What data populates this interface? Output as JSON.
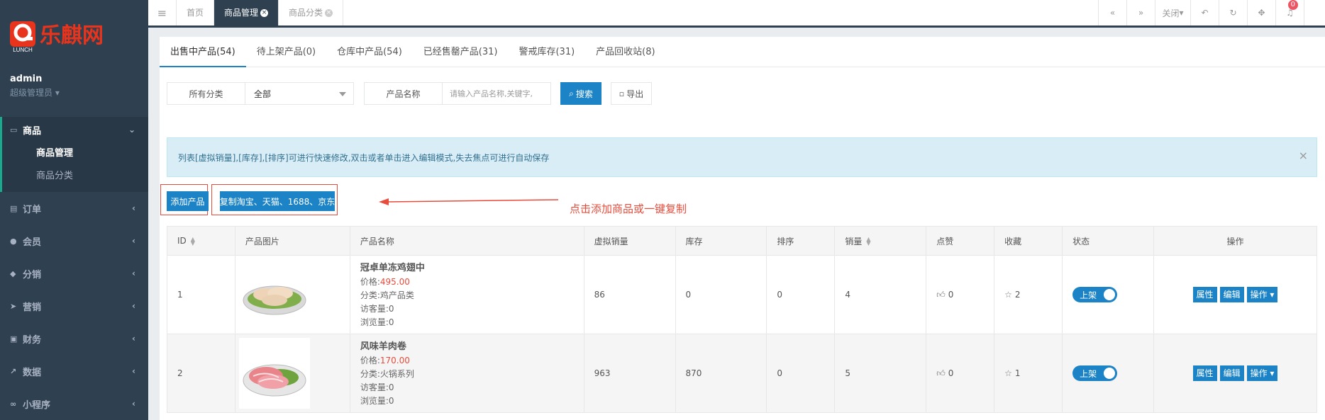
{
  "sidebar": {
    "logo_text": "乐麒网",
    "logo_sub": "LUNCH",
    "user_name": "admin",
    "user_role": "超级管理员",
    "active_group": {
      "label": "商品",
      "items": [
        {
          "label": "商品管理",
          "current": true
        },
        {
          "label": "商品分类",
          "current": false
        }
      ]
    },
    "items": [
      {
        "label": "订单",
        "icon": "order-icon"
      },
      {
        "label": "会员",
        "icon": "user-icon"
      },
      {
        "label": "分销",
        "icon": "distribution-icon"
      },
      {
        "label": "营销",
        "icon": "send-icon"
      },
      {
        "label": "财务",
        "icon": "money-icon"
      },
      {
        "label": "数据",
        "icon": "chart-icon"
      },
      {
        "label": "小程序",
        "icon": "miniprogram-icon"
      }
    ]
  },
  "topbar": {
    "tabs": [
      {
        "label": "首页"
      },
      {
        "label": "商品管理",
        "active": true
      },
      {
        "label": "商品分类"
      }
    ],
    "close_label": "关闭",
    "notification_count": "0"
  },
  "product_tabs": [
    "出售中产品(54)",
    "待上架产品(0)",
    "仓库中产品(54)",
    "已经售罄产品(31)",
    "警戒库存(31)",
    "产品回收站(8)"
  ],
  "filter": {
    "category_label": "所有分类",
    "category_value": "全部",
    "name_label": "产品名称",
    "name_placeholder": "请输入产品名称,关键字,",
    "search_label": "搜索",
    "export_label": "导出"
  },
  "alert": {
    "text": "列表[虚拟销量],[库存],[排序]可进行快速修改,双击或者单击进入编辑模式,失去焦点可进行自动保存"
  },
  "actions": {
    "add_label": "添加产品",
    "copy_label": "复制淘宝、天猫、1688、京东",
    "annotation": "点击添加商品或一键复制"
  },
  "table": {
    "headers": [
      "ID",
      "产品图片",
      "产品名称",
      "虚拟销量",
      "库存",
      "排序",
      "销量",
      "点赞",
      "收藏",
      "状态",
      "操作"
    ],
    "rows": [
      {
        "id": "1",
        "name": "冠卓单冻鸡翅中",
        "price_label": "价格:",
        "price": "495.00",
        "category": "分类:鸡产品类",
        "visitors": "访客量:0",
        "views": "浏览量:0",
        "virtual_sales": "86",
        "stock": "0",
        "sort": "0",
        "sales": "4",
        "likes": "0",
        "favorites": "2",
        "status": "上架"
      },
      {
        "id": "2",
        "name": "风味羊肉卷",
        "price_label": "价格:",
        "price": "170.00",
        "category": "分类:火锅系列",
        "visitors": "访客量:0",
        "views": "浏览量:0",
        "virtual_sales": "963",
        "stock": "870",
        "sort": "0",
        "sales": "5",
        "likes": "0",
        "favorites": "1",
        "status": "上架"
      }
    ],
    "op_labels": {
      "attr": "属性",
      "edit": "编辑",
      "more": "操作"
    }
  }
}
